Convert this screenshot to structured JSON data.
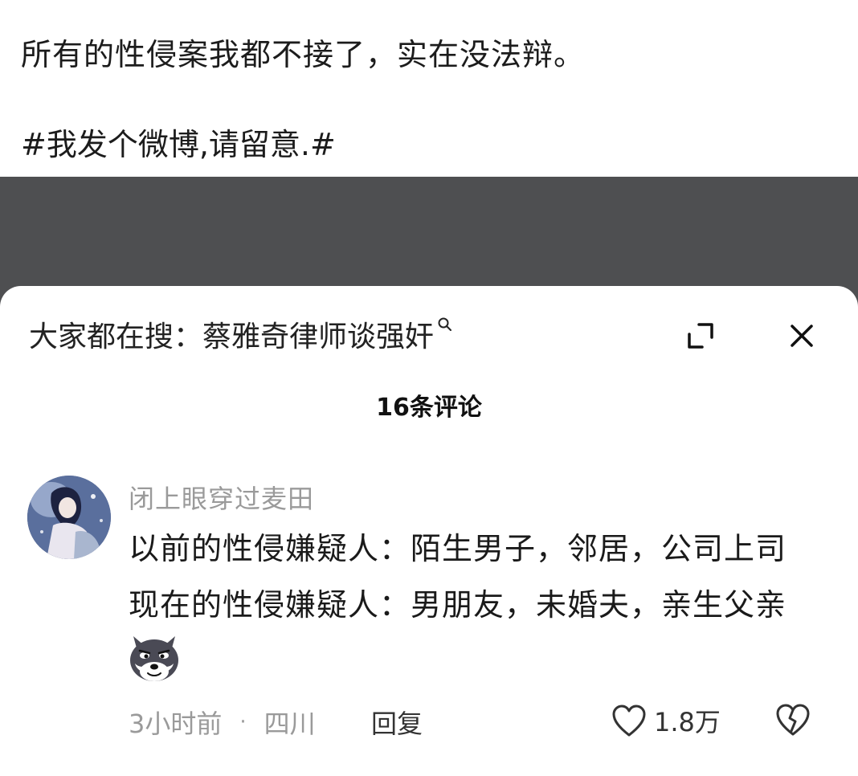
{
  "post": {
    "text": "所有的性侵案我都不接了，实在没法辩。",
    "tag": "#我发个微博,请留意.#"
  },
  "sheet": {
    "search_text": "大家都在搜：蔡雅奇律师谈强奸",
    "search_icon": "search-icon",
    "expand_icon": "expand-icon",
    "close_icon": "close-icon",
    "comment_count": "16条评论"
  },
  "comment": {
    "username": "闭上眼穿过麦田",
    "line1": "以前的性侵嫌疑人：陌生男子，邻居，公司上司",
    "line2": "现在的性侵嫌疑人：男朋友，未婚夫，亲生父亲",
    "emoji": "husky-emoji",
    "time": "3小时前",
    "separator": "·",
    "location": "四川",
    "reply_label": "回复",
    "like_count": "1.8万"
  },
  "colors": {
    "overlay": "#4e4f51",
    "meta_text": "#9a9a9a"
  }
}
